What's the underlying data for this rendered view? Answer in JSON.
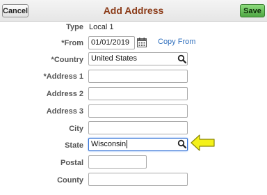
{
  "header": {
    "title": "Add Address",
    "cancel_label": "Cancel",
    "save_label": "Save"
  },
  "form": {
    "type": {
      "label": "Type",
      "value": "Local 1"
    },
    "from": {
      "label": "*From",
      "value": "01/01/2019",
      "copy_link": "Copy From"
    },
    "country": {
      "label": "*Country",
      "value": "United States"
    },
    "address1": {
      "label": "*Address 1",
      "value": ""
    },
    "address2": {
      "label": "Address 2",
      "value": ""
    },
    "address3": {
      "label": "Address 3",
      "value": ""
    },
    "city": {
      "label": "City",
      "value": ""
    },
    "state": {
      "label": "State",
      "value": "Wisconsin"
    },
    "postal": {
      "label": "Postal",
      "value": ""
    },
    "county": {
      "label": "County",
      "value": ""
    }
  },
  "icons": {
    "calendar": "calendar-icon",
    "search": "search-icon",
    "pointer": "arrow-left-icon"
  },
  "colors": {
    "title": "#8b3b18",
    "save_button": "#5cb84f",
    "link": "#2f6fbd",
    "focus_border": "#2f6fd6",
    "arrow_fill": "#f4f11a"
  }
}
